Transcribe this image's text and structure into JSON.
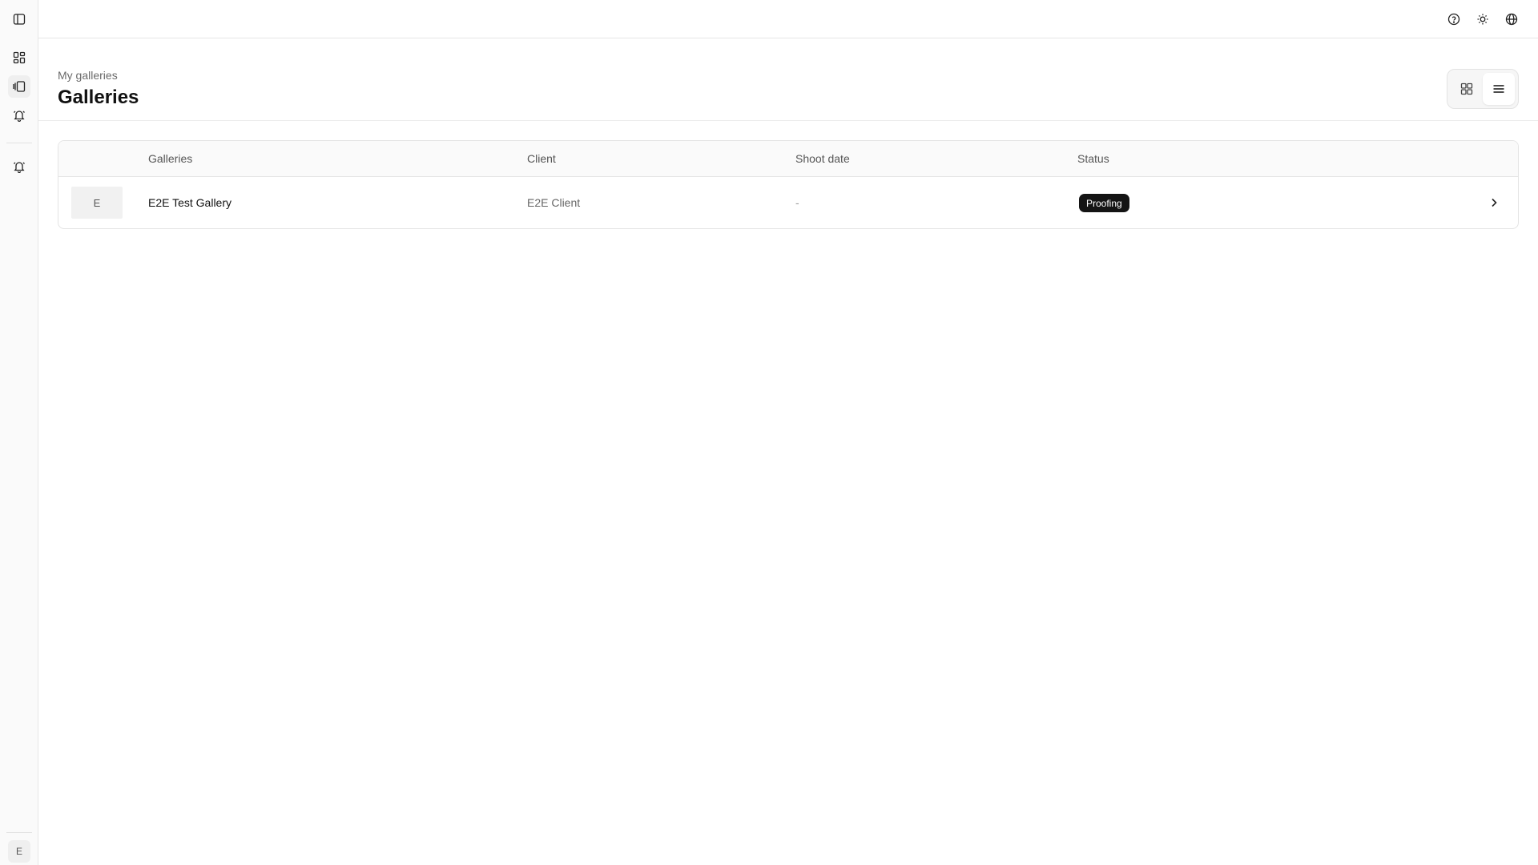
{
  "sidebar": {
    "items": [
      {
        "icon": "sidebar-toggle-icon"
      },
      {
        "icon": "dashboard-icon"
      },
      {
        "icon": "galleries-icon"
      },
      {
        "icon": "notifications-icon"
      },
      {
        "icon": "alerts-icon"
      }
    ],
    "user_initial": "E"
  },
  "topbar": {
    "icons": [
      "help-icon",
      "theme-sun-icon",
      "language-globe-icon"
    ]
  },
  "header": {
    "breadcrumb": "My galleries",
    "title": "Galleries",
    "view_modes": [
      "grid",
      "list"
    ],
    "selected_view": "list"
  },
  "table": {
    "columns": [
      "Galleries",
      "Client",
      "Shoot date",
      "Status"
    ],
    "rows": [
      {
        "thumb_initial": "E",
        "name": "E2E Test Gallery",
        "client": "E2E Client",
        "shoot_date": "-",
        "status": "Proofing"
      }
    ]
  },
  "colors": {
    "badge_bg": "#141414",
    "border": "#e4e4e4",
    "muted_text": "#666666"
  }
}
